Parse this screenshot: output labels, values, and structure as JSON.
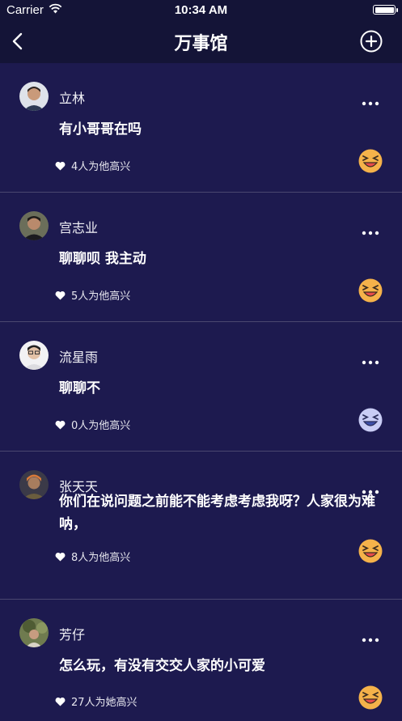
{
  "status": {
    "carrier": "Carrier",
    "time": "10:34 AM"
  },
  "nav": {
    "title": "万事馆"
  },
  "posts": [
    {
      "user": "立林",
      "content": "有小哥哥在吗",
      "likes": "4人为他高兴",
      "reaction": "laughing",
      "emoji_color": "#f5b24a"
    },
    {
      "user": "宫志业",
      "content": "聊聊呗  我主动",
      "likes": "5人为他高兴",
      "reaction": "laughing",
      "emoji_color": "#f5b24a"
    },
    {
      "user": "流星雨",
      "content": "聊聊不",
      "likes": "0人为他高兴",
      "reaction": "laughing",
      "emoji_color": "#c9cdf5"
    },
    {
      "user": "张天天",
      "content": "你们在说问题之前能不能考虑考虑我呀？人家很为难呐，",
      "likes": "8人为他高兴",
      "reaction": "laughing",
      "emoji_color": "#f5b24a"
    },
    {
      "user": "芳仔",
      "content": "怎么玩，有没有交交人家的小可爱",
      "likes": "27人为她高兴",
      "reaction": "laughing",
      "emoji_color": "#f5b24a"
    }
  ]
}
